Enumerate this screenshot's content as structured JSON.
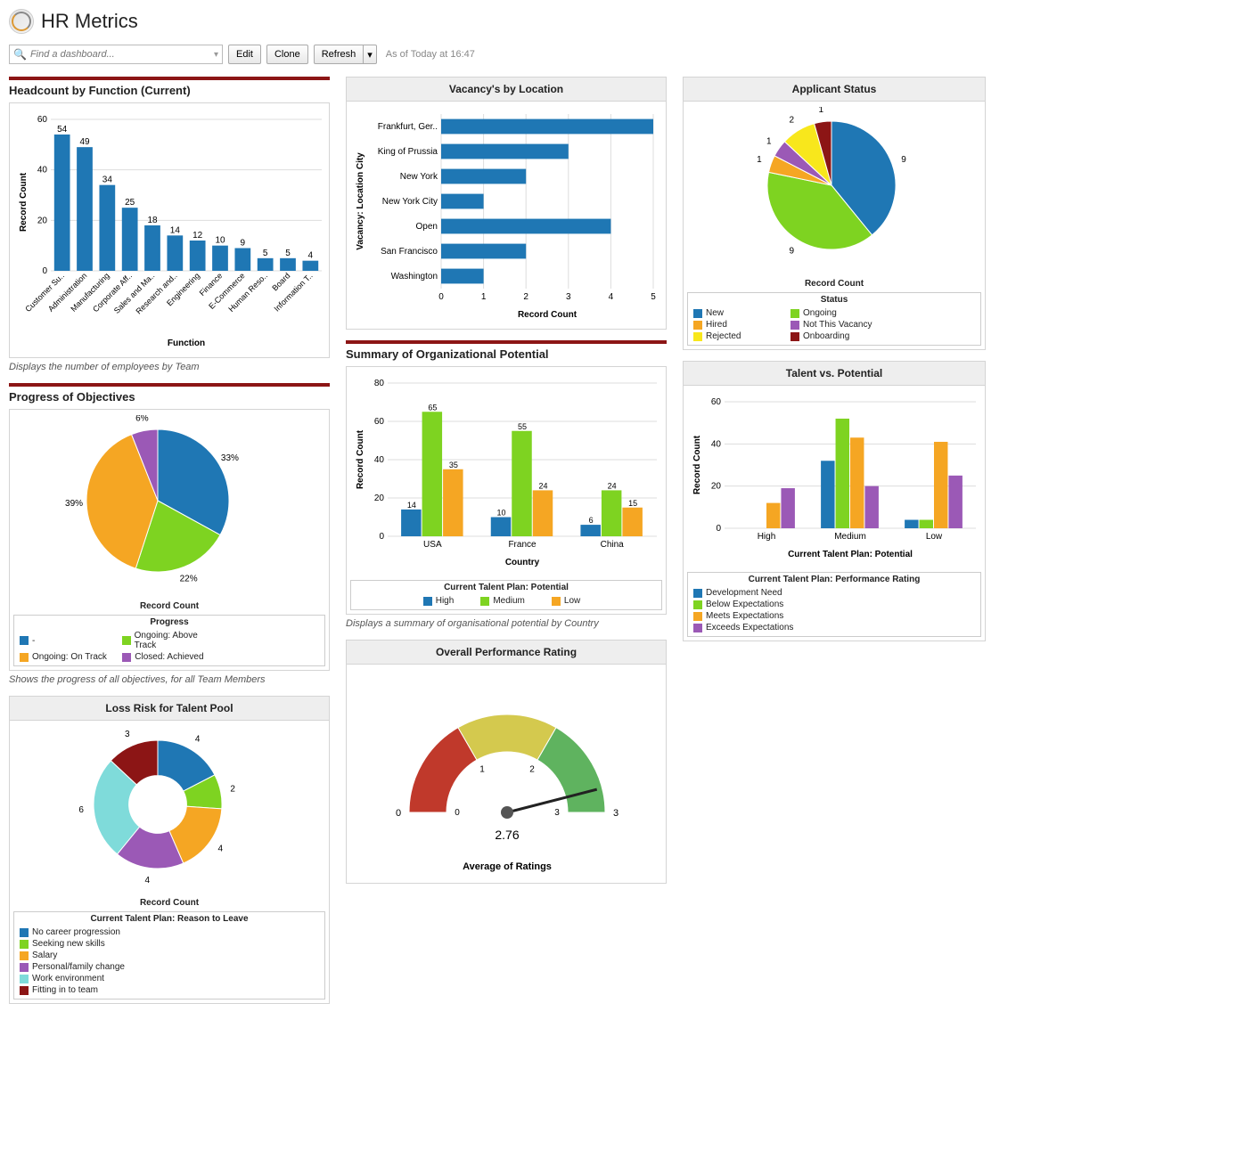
{
  "header": {
    "title": "HR Metrics"
  },
  "toolbar": {
    "search_placeholder": "Find a dashboard...",
    "edit": "Edit",
    "clone": "Clone",
    "refresh": "Refresh",
    "timestamp": "As of Today at 16:47"
  },
  "colors": {
    "blue": "#1f77b4",
    "green": "#7ed321",
    "orange": "#f5a623",
    "maroon": "#8c1515",
    "purple": "#9b59b6",
    "yellow": "#f8e71c",
    "teal": "#7fdbda",
    "red": "#d0021b",
    "gauge_red": "#c0392b",
    "gauge_yellow": "#d4c94e",
    "gauge_green": "#5fb35f"
  },
  "chart_data": [
    {
      "id": "headcount",
      "title": "Headcount by Function (Current)",
      "type": "bar",
      "xlabel": "Function",
      "ylabel": "Record Count",
      "ylim": [
        0,
        60
      ],
      "yticks": [
        0,
        20,
        40,
        60
      ],
      "categories": [
        "Customer Su..",
        "Administration",
        "Manufacturing",
        "Corporate Aff..",
        "Sales and Ma..",
        "Research and..",
        "Engineering",
        "Finance",
        "E-Commerce",
        "Human Reso..",
        "Board",
        "Information T.."
      ],
      "values": [
        54,
        49,
        34,
        25,
        18,
        14,
        12,
        10,
        9,
        5,
        5,
        4
      ],
      "caption": "Displays the number of employees by Team"
    },
    {
      "id": "vacancies",
      "title": "Vacancy's by Location",
      "type": "bar_horizontal",
      "xlabel": "Record Count",
      "ylabel": "Vacancy: Location City",
      "xlim": [
        0,
        5
      ],
      "xticks": [
        0,
        1,
        2,
        3,
        4,
        5
      ],
      "categories": [
        "Frankfurt, Ger..",
        "King of Prussia",
        "New York",
        "New York City",
        "Open",
        "San Francisco",
        "Washington"
      ],
      "values": [
        5.0,
        3.0,
        2.0,
        1.0,
        4.0,
        2.0,
        1.0
      ]
    },
    {
      "id": "applicant",
      "title": "Applicant Status",
      "type": "pie",
      "value_label": "Record Count",
      "legend_title": "Status",
      "slices": [
        {
          "label": "New",
          "value": 9,
          "color": "#1f77b4"
        },
        {
          "label": "Ongoing",
          "value": 9,
          "color": "#7ed321"
        },
        {
          "label": "Hired",
          "value": 1,
          "color": "#f5a623"
        },
        {
          "label": "Not This Vacancy",
          "value": 1,
          "color": "#9b59b6"
        },
        {
          "label": "Rejected",
          "value": 2,
          "color": "#f8e71c"
        },
        {
          "label": "Onboarding",
          "value": 1,
          "color": "#8c1515"
        }
      ]
    },
    {
      "id": "objectives",
      "title": "Progress of Objectives",
      "type": "pie",
      "value_label": "Record Count",
      "legend_title": "Progress",
      "slices": [
        {
          "label": "-",
          "value": 33,
          "display": "33%",
          "color": "#1f77b4"
        },
        {
          "label": "Ongoing: Above Track",
          "value": 22,
          "display": "22%",
          "color": "#7ed321"
        },
        {
          "label": "Ongoing: On Track",
          "value": 39,
          "display": "39%",
          "color": "#f5a623"
        },
        {
          "label": "Closed: Achieved",
          "value": 6,
          "display": "6%",
          "color": "#9b59b6"
        }
      ],
      "caption": "Shows the progress of all objectives, for all Team Members"
    },
    {
      "id": "orgpotential",
      "title": "Summary of Organizational Potential",
      "type": "bar_grouped",
      "xlabel": "Country",
      "ylabel": "Record Count",
      "ylim": [
        0,
        80
      ],
      "yticks": [
        0,
        20,
        40,
        60,
        80
      ],
      "categories": [
        "USA",
        "France",
        "China"
      ],
      "legend_title": "Current Talent Plan: Potential",
      "series": [
        {
          "name": "High",
          "color": "#1f77b4",
          "values": [
            14,
            10,
            6
          ]
        },
        {
          "name": "Medium",
          "color": "#7ed321",
          "values": [
            65,
            55,
            24
          ]
        },
        {
          "name": "Low",
          "color": "#f5a623",
          "values": [
            35,
            24,
            15
          ]
        }
      ],
      "caption": "Displays a summary of organisational potential by Country"
    },
    {
      "id": "talentpotential",
      "title": "Talent vs. Potential",
      "type": "bar_grouped",
      "xlabel": "Current Talent Plan: Potential",
      "ylabel": "Record Count",
      "ylim": [
        0,
        60
      ],
      "yticks": [
        0,
        20,
        40,
        60
      ],
      "categories": [
        "High",
        "Medium",
        "Low"
      ],
      "legend_title": "Current Talent Plan: Performance Rating",
      "series": [
        {
          "name": "Development Need",
          "color": "#1f77b4",
          "values": [
            0,
            32,
            4
          ]
        },
        {
          "name": "Below Expectations",
          "color": "#7ed321",
          "values": [
            0,
            52,
            4
          ]
        },
        {
          "name": "Meets Expectations",
          "color": "#f5a623",
          "values": [
            12,
            43,
            41
          ]
        },
        {
          "name": "Exceeds Expectations",
          "color": "#9b59b6",
          "values": [
            19,
            20,
            25
          ]
        }
      ]
    },
    {
      "id": "lossrisk",
      "title": "Loss Risk for Talent Pool",
      "type": "donut",
      "value_label": "Record Count",
      "legend_title": "Current Talent Plan: Reason to Leave",
      "slices": [
        {
          "label": "No career progression",
          "value": 4,
          "color": "#1f77b4"
        },
        {
          "label": "Seeking new skills",
          "value": 2,
          "color": "#7ed321"
        },
        {
          "label": "Salary",
          "value": 4,
          "color": "#f5a623"
        },
        {
          "label": "Personal/family change",
          "value": 4,
          "color": "#9b59b6"
        },
        {
          "label": "Work environment",
          "value": 6,
          "color": "#7fdbda"
        },
        {
          "label": "Fitting in to team",
          "value": 3,
          "color": "#8c1515"
        }
      ]
    },
    {
      "id": "overallperf",
      "title": "Overall Performance Rating",
      "type": "gauge",
      "min": 0,
      "max": 3,
      "value": 2.76,
      "value_display": "2.76",
      "footer": "Average of Ratings",
      "bands": [
        {
          "from": 0,
          "to": 1,
          "color": "#c0392b"
        },
        {
          "from": 1,
          "to": 2,
          "color": "#d4c94e"
        },
        {
          "from": 2,
          "to": 3,
          "color": "#5fb35f"
        }
      ]
    }
  ]
}
